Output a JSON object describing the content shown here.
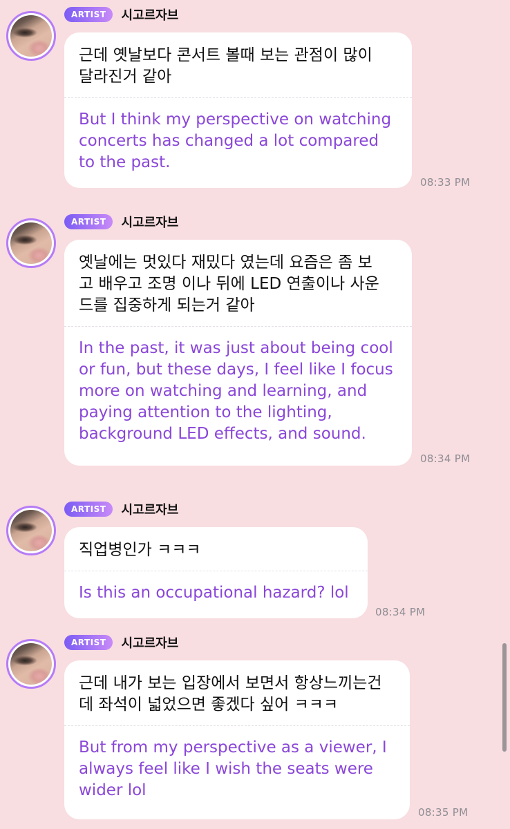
{
  "messages": [
    {
      "badge": "ARTIST",
      "name": "시고르자브",
      "korean": "근데 옛날보다 콘서트 볼때 보는 관점이 많이\n달라진거 같아",
      "english": "But I think my perspective on watching\nconcerts has changed a lot compared\nto the past.",
      "time": "08:33 PM"
    },
    {
      "badge": "ARTIST",
      "name": "시고르자브",
      "korean": "옛날에는 멋있다 재밌다 였는데 요즘은 좀 보\n고 배우고 조명 이나 뒤에 LED 연출이나 사운\n드를 집중하게 되는거 같아",
      "english": "In the past, it was just about being cool\nor fun, but these days, I feel like I focus\nmore on watching and learning, and\npaying attention to the lighting,\nbackground LED effects, and sound.",
      "time": "08:34 PM"
    },
    {
      "badge": "ARTIST",
      "name": "시고르자브",
      "korean": "직업병인가 ㅋㅋㅋ",
      "english": "Is this an occupational hazard? lol",
      "time": "08:34 PM"
    },
    {
      "badge": "ARTIST",
      "name": "시고르자브",
      "korean": "근데 내가 보는 입장에서 보면서 항상느끼는건\n데 좌석이 넓었으면 좋겠다 싶어 ㅋㅋㅋ",
      "english": "But from my perspective as a viewer, I\nalways feel like I wish the seats were\nwider lol",
      "time": "08:35 PM"
    }
  ]
}
